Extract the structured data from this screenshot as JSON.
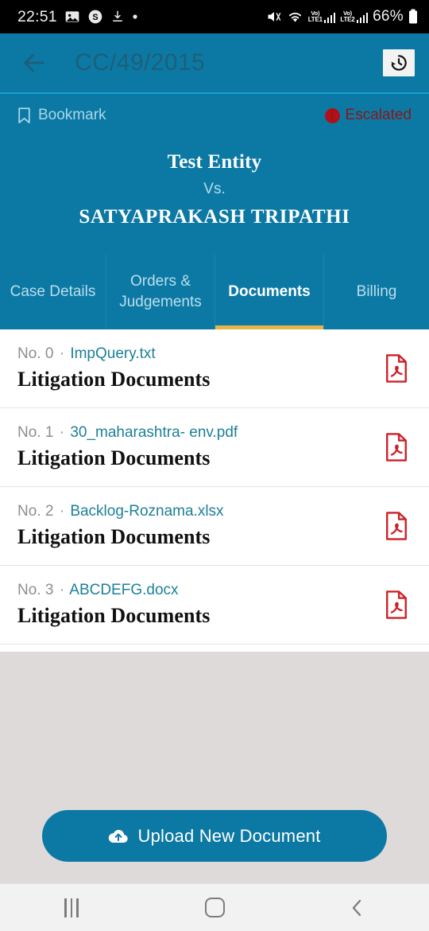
{
  "status_bar": {
    "time": "22:51",
    "left_icons": [
      "image-icon",
      "skype-icon",
      "download-icon",
      "dot-icon"
    ],
    "right_icons": [
      "mute-icon",
      "wifi-icon",
      "volte-lte1-icon",
      "signal-bars-1-icon",
      "volte-lte2-icon",
      "signal-bars-2-icon"
    ],
    "volte_label": "Vo)",
    "sim1_label": "LTE1",
    "sim2_label": "LTE2",
    "battery": "66%"
  },
  "appbar": {
    "back_icon": "back-arrow-icon",
    "case_number": "CC/49/2015",
    "history_icon": "history-icon"
  },
  "case_header": {
    "bookmark_icon": "bookmark-outline-icon",
    "bookmark_label": "Bookmark",
    "escalated_icon": "error-circle-icon",
    "escalated_mark": "!",
    "escalated_label": "Escalated",
    "petitioner": "Test Entity",
    "vs": "Vs.",
    "respondent": "SATYAPRAKASH TRIPATHI"
  },
  "tabs": [
    {
      "label": "Case Details",
      "active": false
    },
    {
      "label": "Orders & Judgements",
      "active": false
    },
    {
      "label": "Documents",
      "active": true
    },
    {
      "label": "Billing",
      "active": false
    }
  ],
  "documents": [
    {
      "index": "No. 0",
      "separator": "·",
      "file_name": "ImpQuery.txt",
      "title": "Litigation Documents",
      "file_icon": "pdf-file-icon"
    },
    {
      "index": "No. 1",
      "separator": "·",
      "file_name": "30_maharashtra- env.pdf",
      "title": "Litigation Documents",
      "file_icon": "pdf-file-icon"
    },
    {
      "index": "No. 2",
      "separator": "·",
      "file_name": "Backlog-Roznama.xlsx",
      "title": "Litigation Documents",
      "file_icon": "pdf-file-icon"
    },
    {
      "index": "No. 3",
      "separator": "·",
      "file_name": "ABCDEFG.docx",
      "title": "Litigation Documents",
      "file_icon": "pdf-file-icon"
    }
  ],
  "upload_button": {
    "icon": "cloud-upload-icon",
    "label": "Upload New Document"
  },
  "nav_bar": {
    "recents_icon": "recents-icon",
    "home_icon": "home-icon",
    "back_icon": "back-chevron-icon"
  },
  "colors": {
    "brand_teal": "#0c79a4",
    "accent_amber": "#e8b44a",
    "link_teal": "#1d8098",
    "escalated_red": "#b01118",
    "pdf_red": "#cc2127",
    "surface_gray": "#dedad9"
  }
}
